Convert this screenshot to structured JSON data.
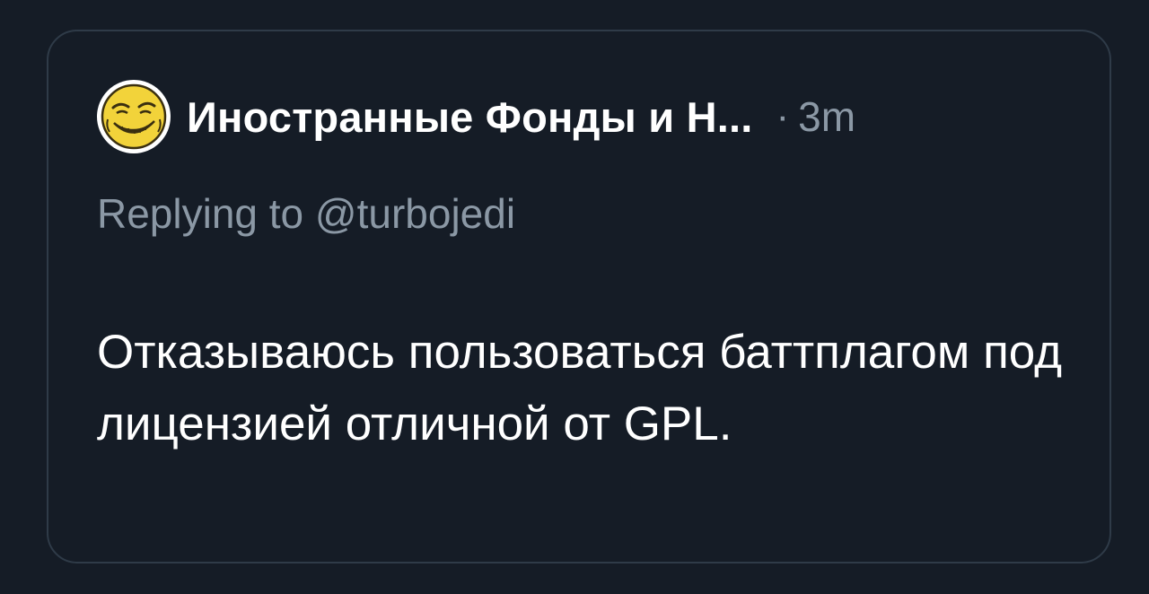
{
  "tweet": {
    "author_name": "Иностранные Фонды и Н...",
    "separator": "·",
    "time": "3m",
    "reply_prefix": "Replying to ",
    "reply_handle": "@turbojedi",
    "text": "Отказываюсь пользоваться баттплагом под лицензией отличной от GPL."
  },
  "colors": {
    "background": "#151c26",
    "border": "#2f3b48",
    "primary_text": "#ffffff",
    "secondary_text": "#8b98a5",
    "avatar_face": "#f2d33a"
  },
  "icons": {
    "avatar": "troll-smiley-avatar"
  }
}
